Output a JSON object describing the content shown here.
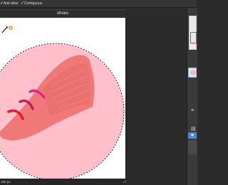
{
  "options": {
    "anti_alias_label": "Anti-alias",
    "contiguous_label": "Contiguous",
    "check_glyph": "✓"
  },
  "document": {
    "title": "shoes",
    "zoom_status": "100 px"
  },
  "colors": {
    "circle": "#ffc0cb",
    "shoe": "#f07878",
    "stroke_magenta": "#e0208a",
    "stroke_crimson": "#c02050",
    "stroke_red": "#e21f2a",
    "selected_layer": "#4f87c7"
  },
  "icons": {
    "wand": "magic-wand-icon",
    "add_badge": "plus-badge-icon",
    "menu": "hamburger-icon",
    "layers": "layers-icon",
    "eye": "eye-icon"
  },
  "panel": {
    "layer_visible_glyph": "👁",
    "menu_glyph": "≡",
    "stack_glyph": "▤"
  }
}
